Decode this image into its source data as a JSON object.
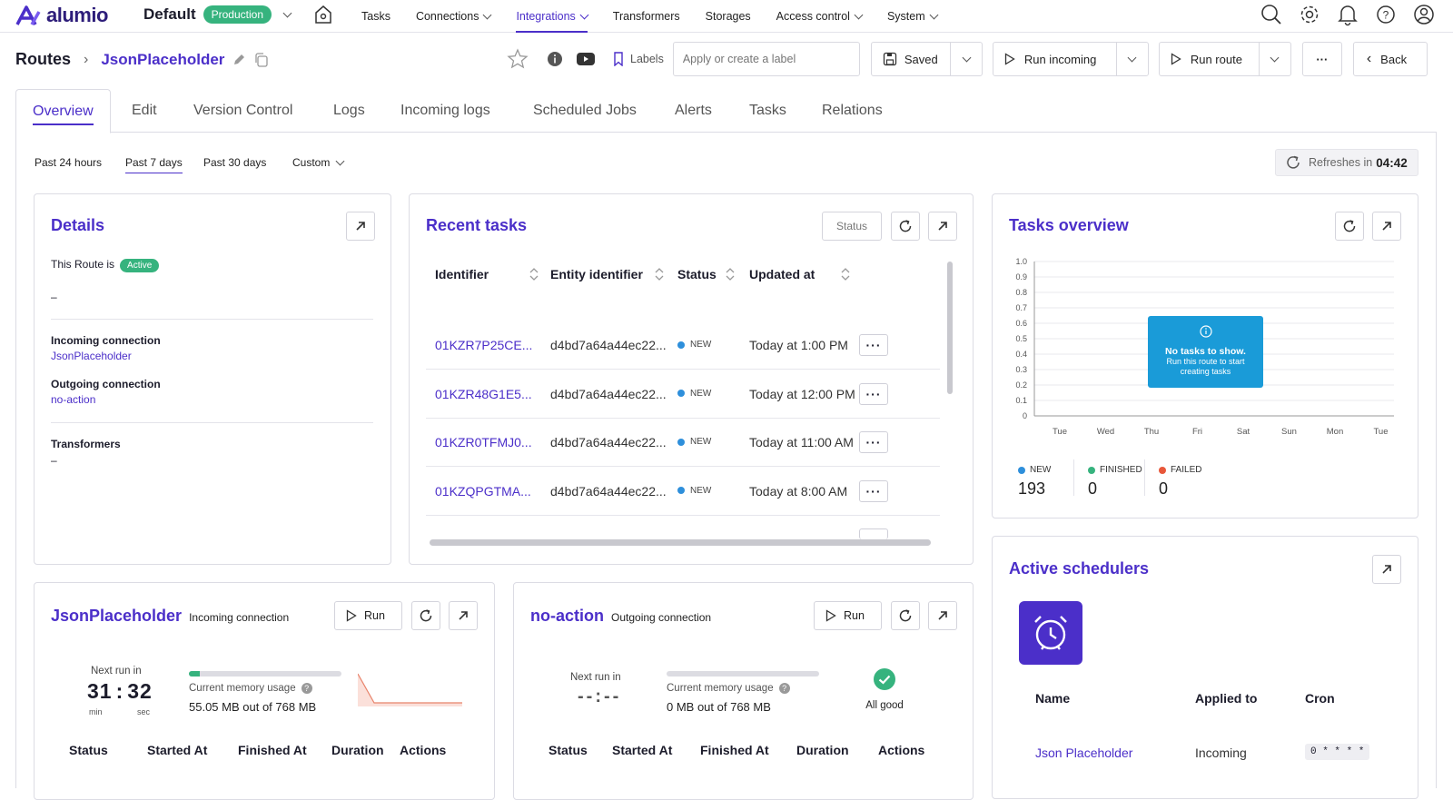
{
  "app": {
    "logo_text": "alumio",
    "environment": "Default",
    "env_badge": "Production"
  },
  "nav": {
    "items": [
      {
        "label": "Tasks",
        "dropdown": false
      },
      {
        "label": "Connections",
        "dropdown": true
      },
      {
        "label": "Integrations",
        "dropdown": true,
        "active": true
      },
      {
        "label": "Transformers",
        "dropdown": false
      },
      {
        "label": "Storages",
        "dropdown": false
      },
      {
        "label": "Access control",
        "dropdown": true
      },
      {
        "label": "System",
        "dropdown": true
      }
    ],
    "icons": [
      "search-icon",
      "settings-icon",
      "bell-icon",
      "help-icon",
      "user-icon"
    ]
  },
  "header": {
    "breadcrumb_root": "Routes",
    "route_name": "JsonPlaceholder",
    "labels_label": "Labels",
    "label_placeholder": "Apply or create a label",
    "saved_label": "Saved",
    "run_incoming_label": "Run incoming",
    "run_route_label": "Run route",
    "more_label": "···",
    "back_label": "Back"
  },
  "tabs": [
    "Overview",
    "Edit",
    "Version Control",
    "Logs",
    "Incoming logs",
    "Scheduled Jobs",
    "Alerts",
    "Tasks",
    "Relations"
  ],
  "period": {
    "options": [
      "Past 24 hours",
      "Past 7 days",
      "Past 30 days",
      "Custom"
    ],
    "selected": "Past 7 days",
    "refresh_text": "Refreshes in",
    "refresh_time": "04:42"
  },
  "details": {
    "title": "Details",
    "route_is": "This Route is",
    "status_badge": "Active",
    "description": "–",
    "incoming_label": "Incoming connection",
    "incoming_value": "JsonPlaceholder",
    "outgoing_label": "Outgoing connection",
    "outgoing_value": "no-action",
    "transformers_label": "Transformers",
    "transformers_value": "–"
  },
  "recent_tasks": {
    "title": "Recent tasks",
    "status_filter": "Status",
    "columns": [
      "Identifier",
      "Entity identifier",
      "Status",
      "Updated at"
    ],
    "rows": [
      {
        "id": "01KZR7P25CE...",
        "entity": "d4bd7a64a44ec22...",
        "status": "NEW",
        "updated": "Today at 1:00 PM"
      },
      {
        "id": "01KZR48G1E5...",
        "entity": "d4bd7a64a44ec22...",
        "status": "NEW",
        "updated": "Today at 12:00 PM"
      },
      {
        "id": "01KZR0TFMJ0...",
        "entity": "d4bd7a64a44ec22...",
        "status": "NEW",
        "updated": "Today at 11:00 AM"
      },
      {
        "id": "01KZQPGTMA...",
        "entity": "d4bd7a64a44ec22...",
        "status": "NEW",
        "updated": "Today at 8:00 AM"
      }
    ],
    "row_action": "···"
  },
  "tasks_overview": {
    "title": "Tasks overview",
    "empty_title": "No tasks to show.",
    "empty_text": "Run this route to start creating tasks",
    "legend": [
      {
        "label": "NEW",
        "value": "193",
        "color": "#2e8fdb"
      },
      {
        "label": "FINISHED",
        "value": "0",
        "color": "#36b37e"
      },
      {
        "label": "FAILED",
        "value": "0",
        "color": "#e8573a"
      }
    ]
  },
  "chart_data": {
    "type": "line",
    "categories": [
      "Tue",
      "Wed",
      "Thu",
      "Fri",
      "Sat",
      "Sun",
      "Mon",
      "Tue"
    ],
    "y_ticks": [
      "0",
      "0.1",
      "0.2",
      "0.3",
      "0.4",
      "0.5",
      "0.6",
      "0.7",
      "0.8",
      "0.9",
      "1.0"
    ],
    "ylim": [
      0,
      1.0
    ],
    "grid": true,
    "series": []
  },
  "incoming_card": {
    "title": "JsonPlaceholder",
    "subtitle": "Incoming connection",
    "run_label": "Run",
    "next_run_label": "Next run in",
    "countdown_min": "31",
    "countdown_sec": "32",
    "min_label": "min",
    "sec_label": "sec",
    "memory_label": "Current memory usage",
    "memory_value": "55.05 MB out of 768 MB",
    "memory_fraction": 0.07,
    "columns": [
      "Status",
      "Started At",
      "Finished At",
      "Duration",
      "Actions"
    ]
  },
  "outgoing_card": {
    "title": "no-action",
    "subtitle": "Outgoing connection",
    "run_label": "Run",
    "next_run_label": "Next run in",
    "countdown": "--:--",
    "memory_label": "Current memory usage",
    "memory_value": "0 MB out of 768 MB",
    "memory_fraction": 0,
    "health_label": "All good",
    "columns": [
      "Status",
      "Started At",
      "Finished At",
      "Duration",
      "Actions"
    ]
  },
  "schedulers": {
    "title": "Active schedulers",
    "columns": [
      "Name",
      "Applied to",
      "Cron"
    ],
    "rows": [
      {
        "name": "Json Placeholder",
        "applied_to": "Incoming",
        "cron": "0 * * * *"
      }
    ]
  }
}
